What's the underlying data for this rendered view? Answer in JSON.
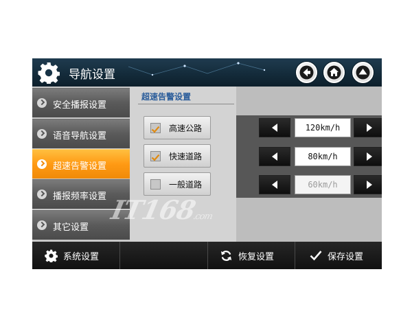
{
  "header": {
    "title": "导航设置"
  },
  "sidebar": {
    "items": [
      {
        "label": "安全播报设置"
      },
      {
        "label": "语音导航设置"
      },
      {
        "label": "超速告警设置"
      },
      {
        "label": "播报频率设置"
      },
      {
        "label": "其它设置"
      }
    ],
    "active_index": 2
  },
  "content": {
    "section_title": "超速告警设置",
    "rows": [
      {
        "label": "高速公路",
        "checked": true,
        "value": "120km/h"
      },
      {
        "label": "快速道路",
        "checked": true,
        "value": "80km/h"
      },
      {
        "label": "一般道路",
        "checked": false,
        "value": "60km/h"
      }
    ]
  },
  "footer": {
    "system_label": "系统设置",
    "restore_label": "恢复设置",
    "save_label": "保存设置"
  },
  "watermark": {
    "text": "IT168",
    "suffix": ".com"
  },
  "colors": {
    "accent": "#ff9a14",
    "header": "#132a39",
    "section_title": "#2a5c9a"
  },
  "icons": {
    "header": "gear-icon",
    "nav": [
      "back-arrow-icon",
      "home-icon",
      "up-arrow-icon"
    ],
    "footer": [
      "gear-icon",
      "refresh-icon",
      "checkmark-icon"
    ]
  }
}
